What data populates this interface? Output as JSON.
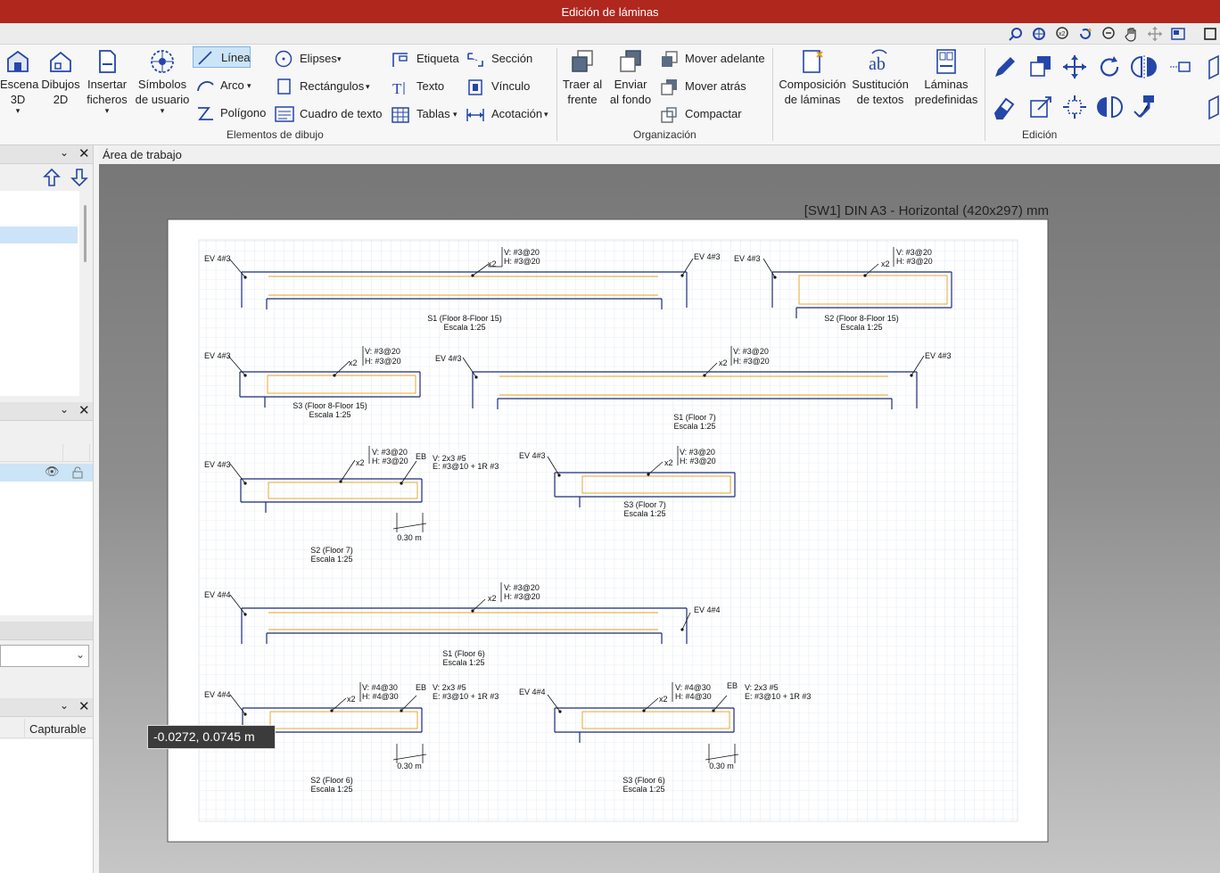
{
  "window": {
    "title": "Edición de láminas"
  },
  "ribbon": {
    "escena": "Escena\n3D",
    "dibujos": "Dibujos\n2D",
    "insertar": "Insertar\nficheros",
    "simbolos": "Símbolos\nde usuario",
    "linea": "Línea",
    "arco": "Arco",
    "poligono": "Polígono",
    "elipses": "Elipses",
    "rectangulos": "Rectángulos",
    "cuadro_texto": "Cuadro de texto",
    "etiqueta": "Etiqueta",
    "texto": "Texto",
    "tablas": "Tablas",
    "seccion": "Sección",
    "vinculo": "Vínculo",
    "acotacion": "Acotación",
    "group_elementos": "Elementos de dibujo",
    "traer": "Traer al\nfrente",
    "enviar": "Enviar\nal fondo",
    "mover_adelante": "Mover adelante",
    "mover_atras": "Mover atrás",
    "compactar": "Compactar",
    "group_organizacion": "Organización",
    "composicion": "Composición\nde láminas",
    "sustitucion": "Sustitución\nde textos",
    "laminas": "Láminas\npredefinidas",
    "group_edicion": "Edición"
  },
  "left_panel": {
    "capturable_header": "Capturable"
  },
  "workspace": {
    "header": "Área de trabajo"
  },
  "sheet": {
    "title": "[SW1] DIN A3 - Horizontal (420x297) mm",
    "texts": [
      {
        "t": "EV 4#3",
        "k": "a1"
      },
      {
        "t": "V: #3@20",
        "k": "a2"
      },
      {
        "t": "H: #3@20",
        "k": "a3"
      },
      {
        "t": "x2",
        "k": "a4"
      },
      {
        "t": "EV 4#3",
        "k": "a5"
      },
      {
        "t": "S1 (Floor 8-Floor 15)",
        "k": "a6"
      },
      {
        "t": "Escala 1:25",
        "k": "a7"
      },
      {
        "t": "EV 4#3",
        "k": "b1"
      },
      {
        "t": "V: #3@20",
        "k": "b2"
      },
      {
        "t": "H: #3@20",
        "k": "b3"
      },
      {
        "t": "x2",
        "k": "b4"
      },
      {
        "t": "S2 (Floor 8-Floor 15)",
        "k": "b5"
      },
      {
        "t": "Escala 1:25",
        "k": "b6"
      },
      {
        "t": "EV 4#3",
        "k": "c1"
      },
      {
        "t": "V: #3@20",
        "k": "c2"
      },
      {
        "t": "H: #3@20",
        "k": "c3"
      },
      {
        "t": "x2",
        "k": "c4"
      },
      {
        "t": "S3 (Floor 8-Floor 15)",
        "k": "c5"
      },
      {
        "t": "Escala 1:25",
        "k": "c6"
      },
      {
        "t": "EV 4#3",
        "k": "d1"
      },
      {
        "t": "V: #3@20",
        "k": "d2"
      },
      {
        "t": "H: #3@20",
        "k": "d3"
      },
      {
        "t": "x2",
        "k": "d4"
      },
      {
        "t": "EV 4#3",
        "k": "d5"
      },
      {
        "t": "S1 (Floor 7)",
        "k": "d6"
      },
      {
        "t": "Escala 1:25",
        "k": "d7"
      },
      {
        "t": "EV 4#3",
        "k": "e1"
      },
      {
        "t": "V: #3@20",
        "k": "e2"
      },
      {
        "t": "H: #3@20",
        "k": "e3"
      },
      {
        "t": "x2",
        "k": "e4"
      },
      {
        "t": "EB",
        "k": "e5"
      },
      {
        "t": "V: 2x3 #5",
        "k": "e6"
      },
      {
        "t": "E: #3@10 + 1R #3",
        "k": "e7"
      },
      {
        "t": "0.30 m",
        "k": "e8"
      },
      {
        "t": "S2 (Floor 7)",
        "k": "e9"
      },
      {
        "t": "Escala 1:25",
        "k": "e10"
      },
      {
        "t": "EV 4#3",
        "k": "f1"
      },
      {
        "t": "V: #3@20",
        "k": "f2"
      },
      {
        "t": "H: #3@20",
        "k": "f3"
      },
      {
        "t": "x2",
        "k": "f4"
      },
      {
        "t": "S3 (Floor 7)",
        "k": "f5"
      },
      {
        "t": "Escala 1:25",
        "k": "f6"
      },
      {
        "t": "EV 4#4",
        "k": "g1"
      },
      {
        "t": "V: #3@20",
        "k": "g2"
      },
      {
        "t": "H: #3@20",
        "k": "g3"
      },
      {
        "t": "x2",
        "k": "g4"
      },
      {
        "t": "EV 4#4",
        "k": "g5"
      },
      {
        "t": "S1 (Floor 6)",
        "k": "g6"
      },
      {
        "t": "Escala 1:25",
        "k": "g7"
      },
      {
        "t": "EV 4#4",
        "k": "h1"
      },
      {
        "t": "V: #4@30",
        "k": "h2"
      },
      {
        "t": "H: #4@30",
        "k": "h3"
      },
      {
        "t": "x2",
        "k": "h4"
      },
      {
        "t": "EB",
        "k": "h5"
      },
      {
        "t": "V: 2x3 #5",
        "k": "h6"
      },
      {
        "t": "E: #3@10 + 1R #3",
        "k": "h7"
      },
      {
        "t": "0.30 m",
        "k": "h8"
      },
      {
        "t": "S2 (Floor 6)",
        "k": "h9"
      },
      {
        "t": "Escala 1:25",
        "k": "h10"
      },
      {
        "t": "EV 4#4",
        "k": "i1"
      },
      {
        "t": "V: #4@30",
        "k": "i2"
      },
      {
        "t": "H: #4@30",
        "k": "i3"
      },
      {
        "t": "x2",
        "k": "i4"
      },
      {
        "t": "EB",
        "k": "i5"
      },
      {
        "t": "V: 2x3 #5",
        "k": "i6"
      },
      {
        "t": "E: #3@10 + 1R #3",
        "k": "i7"
      },
      {
        "t": "0.30 m",
        "k": "i8"
      },
      {
        "t": "S3 (Floor 6)",
        "k": "i9"
      },
      {
        "t": "Escala 1:25",
        "k": "i10"
      }
    ]
  },
  "cursor_readout": "-0.0272, 0.0745 m",
  "colors": {
    "title_bar": "#b0271d",
    "rebar": "#e3a21a",
    "wall": "#1c2a7a",
    "selected": "#cce4f7"
  }
}
